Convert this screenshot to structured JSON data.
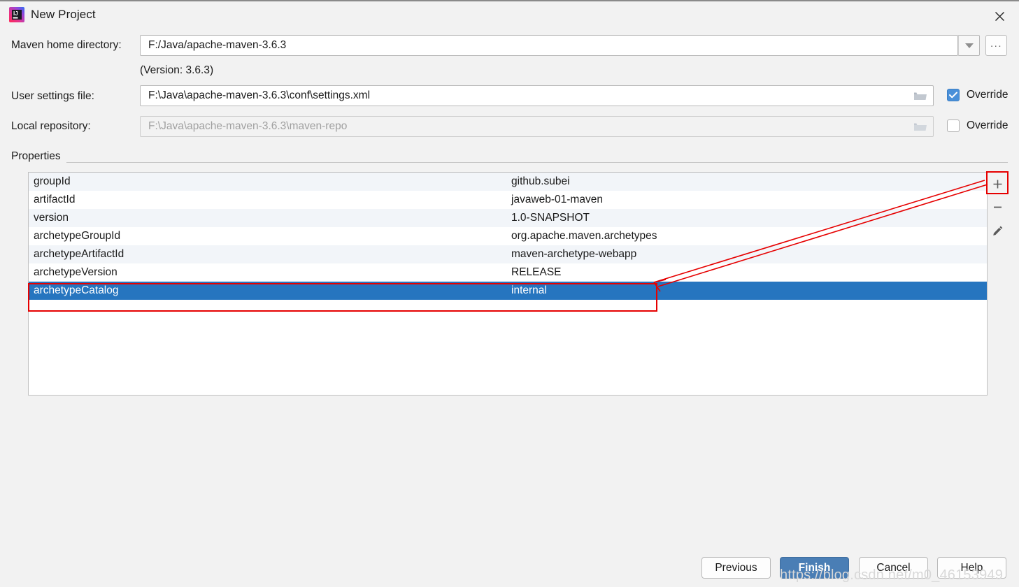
{
  "window": {
    "title": "New Project",
    "logo_icon": "intellij-idea-logo",
    "close_icon": "close-icon"
  },
  "form": {
    "maven_home": {
      "label": "Maven home directory:",
      "value": "F:/Java/apache-maven-3.6.3",
      "dropdown_icon": "chevron-down-icon",
      "browse_label": "...",
      "version_note": "(Version: 3.6.3)"
    },
    "user_settings": {
      "label": "User settings file:",
      "value": "F:\\Java\\apache-maven-3.6.3\\conf\\settings.xml",
      "folder_icon": "folder-icon",
      "override_label": "Override",
      "override_checked": true
    },
    "local_repository": {
      "label": "Local repository:",
      "value": "F:\\Java\\apache-maven-3.6.3\\maven-repo",
      "folder_icon": "folder-icon",
      "override_label": "Override",
      "override_checked": false,
      "disabled": true
    }
  },
  "properties": {
    "group_label": "Properties",
    "rows": [
      {
        "key": "groupId",
        "value": "github.subei",
        "selected": false
      },
      {
        "key": "artifactId",
        "value": "javaweb-01-maven",
        "selected": false
      },
      {
        "key": "version",
        "value": "1.0-SNAPSHOT",
        "selected": false
      },
      {
        "key": "archetypeGroupId",
        "value": "org.apache.maven.archetypes",
        "selected": false
      },
      {
        "key": "archetypeArtifactId",
        "value": "maven-archetype-webapp",
        "selected": false
      },
      {
        "key": "archetypeVersion",
        "value": "RELEASE",
        "selected": false
      },
      {
        "key": "archetypeCatalog",
        "value": "internal",
        "selected": true
      }
    ],
    "toolbar": [
      {
        "name": "add-property-button",
        "icon": "plus-icon",
        "label": "+"
      },
      {
        "name": "remove-property-button",
        "icon": "minus-icon",
        "label": "−"
      },
      {
        "name": "edit-property-button",
        "icon": "pencil-icon",
        "label": ""
      }
    ]
  },
  "footer": {
    "previous_label": "Previous",
    "finish_label": "Finish",
    "cancel_label": "Cancel",
    "help_label": "Help"
  },
  "watermark": "https://blog.csdn.net/m0_46153949",
  "colors": {
    "selection_blue": "#2675bf",
    "accent_blue": "#4a7eb5",
    "checkbox_blue": "#4a90d9",
    "annotation_red": "#e60000",
    "row_alt": "#f2f5f9",
    "dialog_bg": "#f2f2f2"
  }
}
